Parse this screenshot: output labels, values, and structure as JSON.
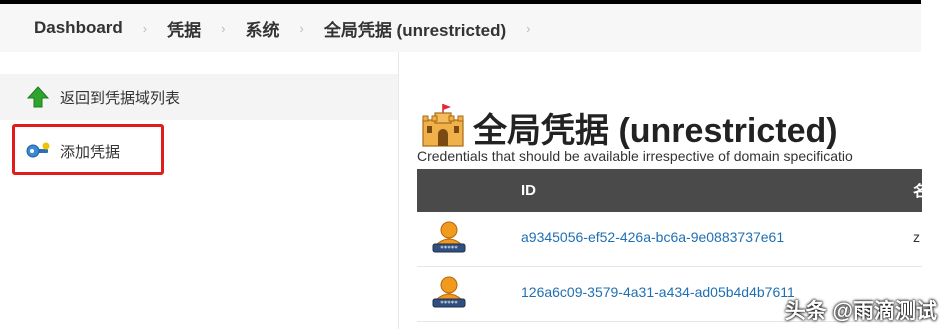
{
  "breadcrumb": {
    "items": [
      "Dashboard",
      "凭据",
      "系统",
      "全局凭据 (unrestricted)"
    ],
    "separator": "›"
  },
  "sidebar": {
    "back_label": "返回到凭据域列表",
    "add_label": "添加凭据"
  },
  "main": {
    "title": "全局凭据 (unrestricted)",
    "description": "Credentials that should be available irrespective of domain specificatio",
    "table": {
      "headers": {
        "id": "ID",
        "name": "名"
      },
      "rows": [
        {
          "id": "a9345056-ef52-426a-bc6a-9e0883737e61",
          "name": "z"
        },
        {
          "id": "126a6c09-3579-4a31-a434-ad05b4d4b7611",
          "name": ""
        }
      ]
    }
  },
  "watermark": "头条 @雨滴测试",
  "colors": {
    "highlight": "#e21b1b",
    "link": "#1f6fb2",
    "table_header": "#4a4a4a"
  }
}
